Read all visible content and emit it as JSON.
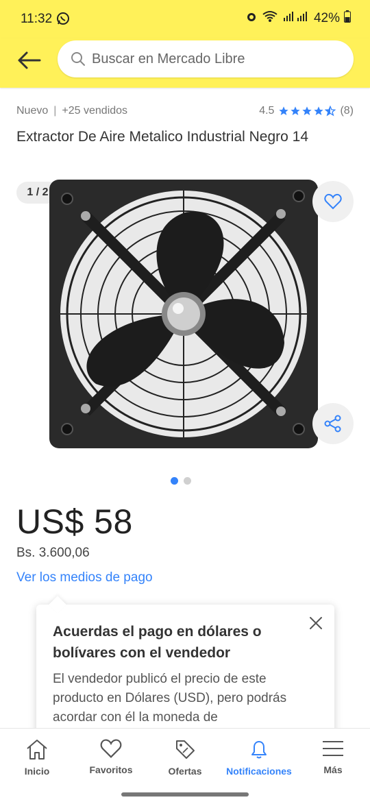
{
  "status": {
    "time": "11:32",
    "battery": "42%"
  },
  "search": {
    "placeholder": "Buscar en Mercado Libre"
  },
  "product": {
    "condition": "Nuevo",
    "sold": "+25 vendidos",
    "rating": "4.5",
    "reviews": "(8)",
    "title": "Extractor De Aire Metalico Industrial Negro 14",
    "counter": "1 / 2",
    "price": "US$ 58",
    "local_price": "Bs. 3.600,06",
    "payment_link": "Ver los medios de pago"
  },
  "tooltip": {
    "title": "Acuerdas el pago en dólares o bolívares con el vendedor",
    "body": "El vendedor publicó el precio de este producto en Dólares (USD), pero podrás acordar con él la moneda de"
  },
  "tabs": [
    {
      "label": "Inicio",
      "icon": "home-icon"
    },
    {
      "label": "Favoritos",
      "icon": "heart-icon"
    },
    {
      "label": "Ofertas",
      "icon": "tag-icon"
    },
    {
      "label": "Notificaciones",
      "icon": "bell-icon"
    },
    {
      "label": "Más",
      "icon": "menu-icon"
    }
  ],
  "colors": {
    "brand_yellow": "#fff159",
    "accent_blue": "#3483fa",
    "star_blue": "#3483fa"
  }
}
